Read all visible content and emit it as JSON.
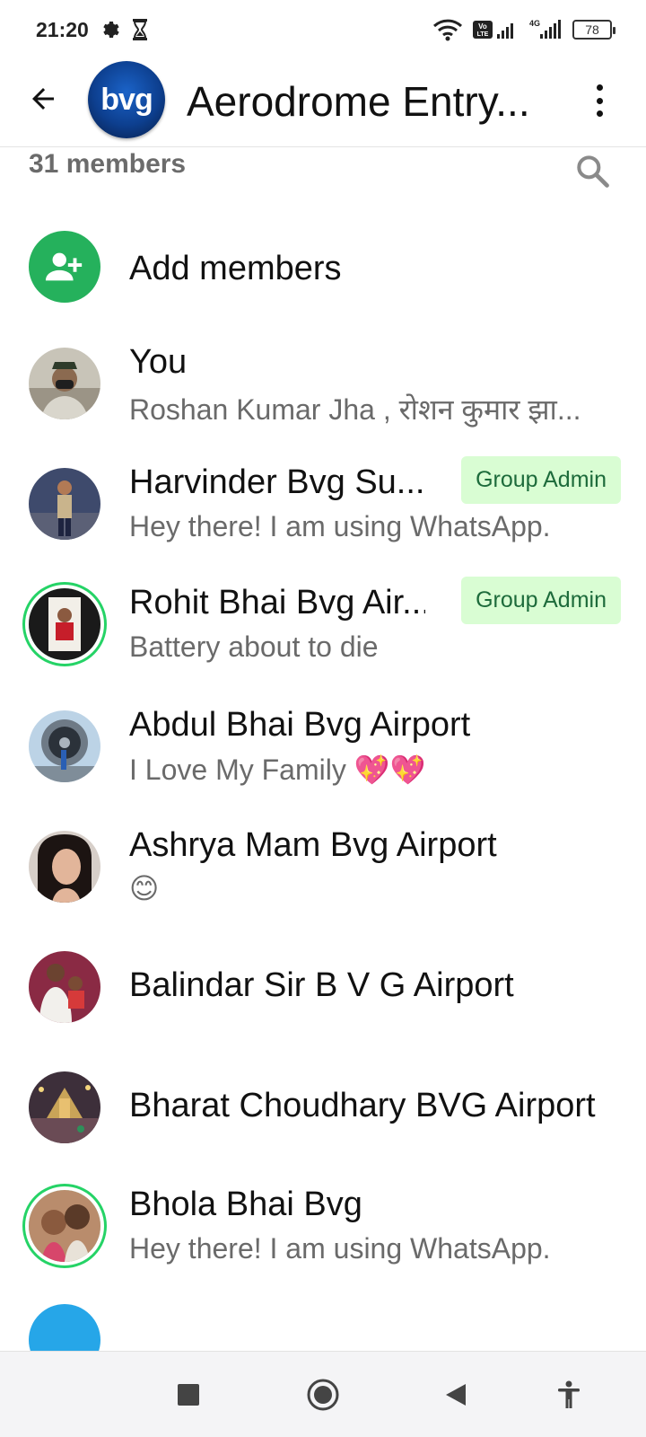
{
  "status_bar": {
    "time": "21:20",
    "battery": "78",
    "icons": [
      "gear-icon",
      "hourglass-icon",
      "wifi-icon",
      "volte-icon",
      "signal-icon",
      "signal-4g-icon",
      "battery-icon"
    ]
  },
  "header": {
    "avatar_text": "bvg",
    "title": "Aerodrome Entry...",
    "icons": [
      "back-arrow-icon",
      "more-vert-icon"
    ]
  },
  "members_count": "31 members",
  "add_members_label": "Add members",
  "members": [
    {
      "name": "You",
      "about": "Roshan Kumar Jha , रोशन कुमार झा...",
      "badge": "",
      "ring": false
    },
    {
      "name": "Harvinder Bvg Su...",
      "about": "Hey there! I am using WhatsApp.",
      "badge": "Group Admin",
      "ring": false
    },
    {
      "name": "Rohit Bhai Bvg Air...",
      "about": "Battery about to die",
      "badge": "Group Admin",
      "ring": true
    },
    {
      "name": "Abdul Bhai Bvg Airport",
      "about": "I Love My Family 💖💖",
      "badge": "",
      "ring": false
    },
    {
      "name": "Ashrya Mam Bvg Airport",
      "about": "😊",
      "badge": "",
      "ring": false
    },
    {
      "name": "Balindar Sir B V G Airport",
      "about": "",
      "badge": "",
      "ring": false
    },
    {
      "name": "Bharat Choudhary BVG Airport",
      "about": "",
      "badge": "",
      "ring": false
    },
    {
      "name": "Bhola Bhai Bvg",
      "about": "Hey there! I am using WhatsApp.",
      "badge": "",
      "ring": true
    }
  ],
  "colors": {
    "accent": "#25b15c",
    "ring": "#25d366",
    "badge_bg": "#d9fdd3",
    "badge_text": "#1d6b3b"
  },
  "nav_bar": [
    "recents-square-icon",
    "home-circle-icon",
    "back-triangle-icon",
    "accessibility-icon"
  ]
}
